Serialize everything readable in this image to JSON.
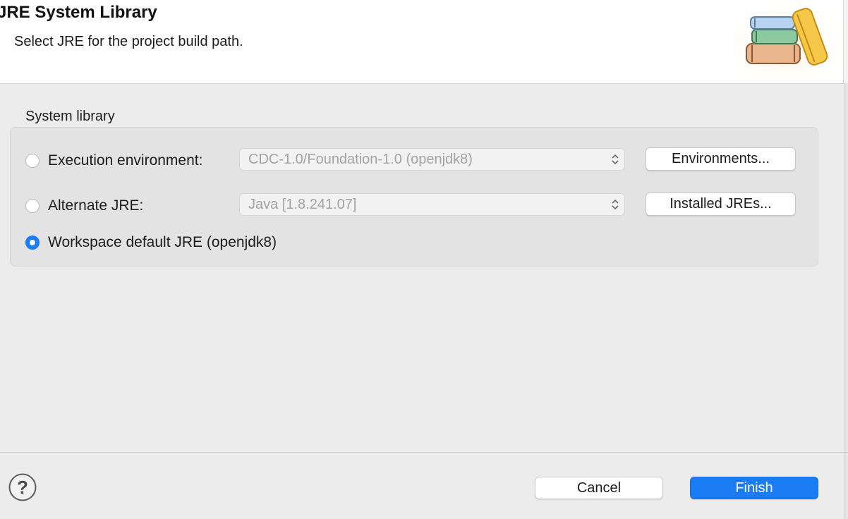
{
  "dialog": {
    "title": "JRE System Library",
    "subtitle": "Select JRE for the project build path."
  },
  "group": {
    "label": "System library",
    "options": [
      {
        "label": "Execution environment:",
        "selected": false
      },
      {
        "label": "Alternate JRE:",
        "selected": false
      },
      {
        "label": "Workspace default JRE (openjdk8)",
        "selected": true
      }
    ],
    "execution_env_combo": {
      "value": "CDC-1.0/Foundation-1.0 (openjdk8)",
      "enabled": false
    },
    "alternate_jre_combo": {
      "value": "Java [1.8.241.07]",
      "enabled": false
    },
    "environments_button": "Environments...",
    "installed_jres_button": "Installed JREs..."
  },
  "footer": {
    "cancel_label": "Cancel",
    "finish_label": "Finish",
    "help_icon": "question-mark-icon"
  },
  "colors": {
    "accent": "#1a7cf5",
    "header_bg": "#ffffff",
    "body_bg": "#ececec",
    "disabled_text": "#a3a3a3"
  },
  "icons": {
    "banner": "library-books-icon",
    "combo": "chevron-up-down-icon"
  }
}
